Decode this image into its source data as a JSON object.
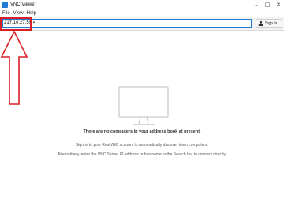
{
  "window": {
    "title": "VNC Viewer",
    "controls": {
      "minimize": "–",
      "maximize": "□",
      "close": "✕"
    }
  },
  "menu": {
    "items": [
      "File",
      "View",
      "Help"
    ]
  },
  "toolbar": {
    "address_value": "217.10.27.59:4",
    "signin_label": "Sign in..."
  },
  "empty_state": {
    "title": "There are no computers in your address book at present.",
    "line1": "Sign in to your RealVNC account to automatically discover team computers.",
    "line2": "Alternatively, enter the VNC Server IP address or hostname in the Search bar to connect directly."
  },
  "colors": {
    "accent": "#1f7ad3",
    "annotation": "#d81f26"
  },
  "icons": {
    "app": "vnc-app-icon",
    "account": "person-icon",
    "empty": "monitor-icon"
  }
}
